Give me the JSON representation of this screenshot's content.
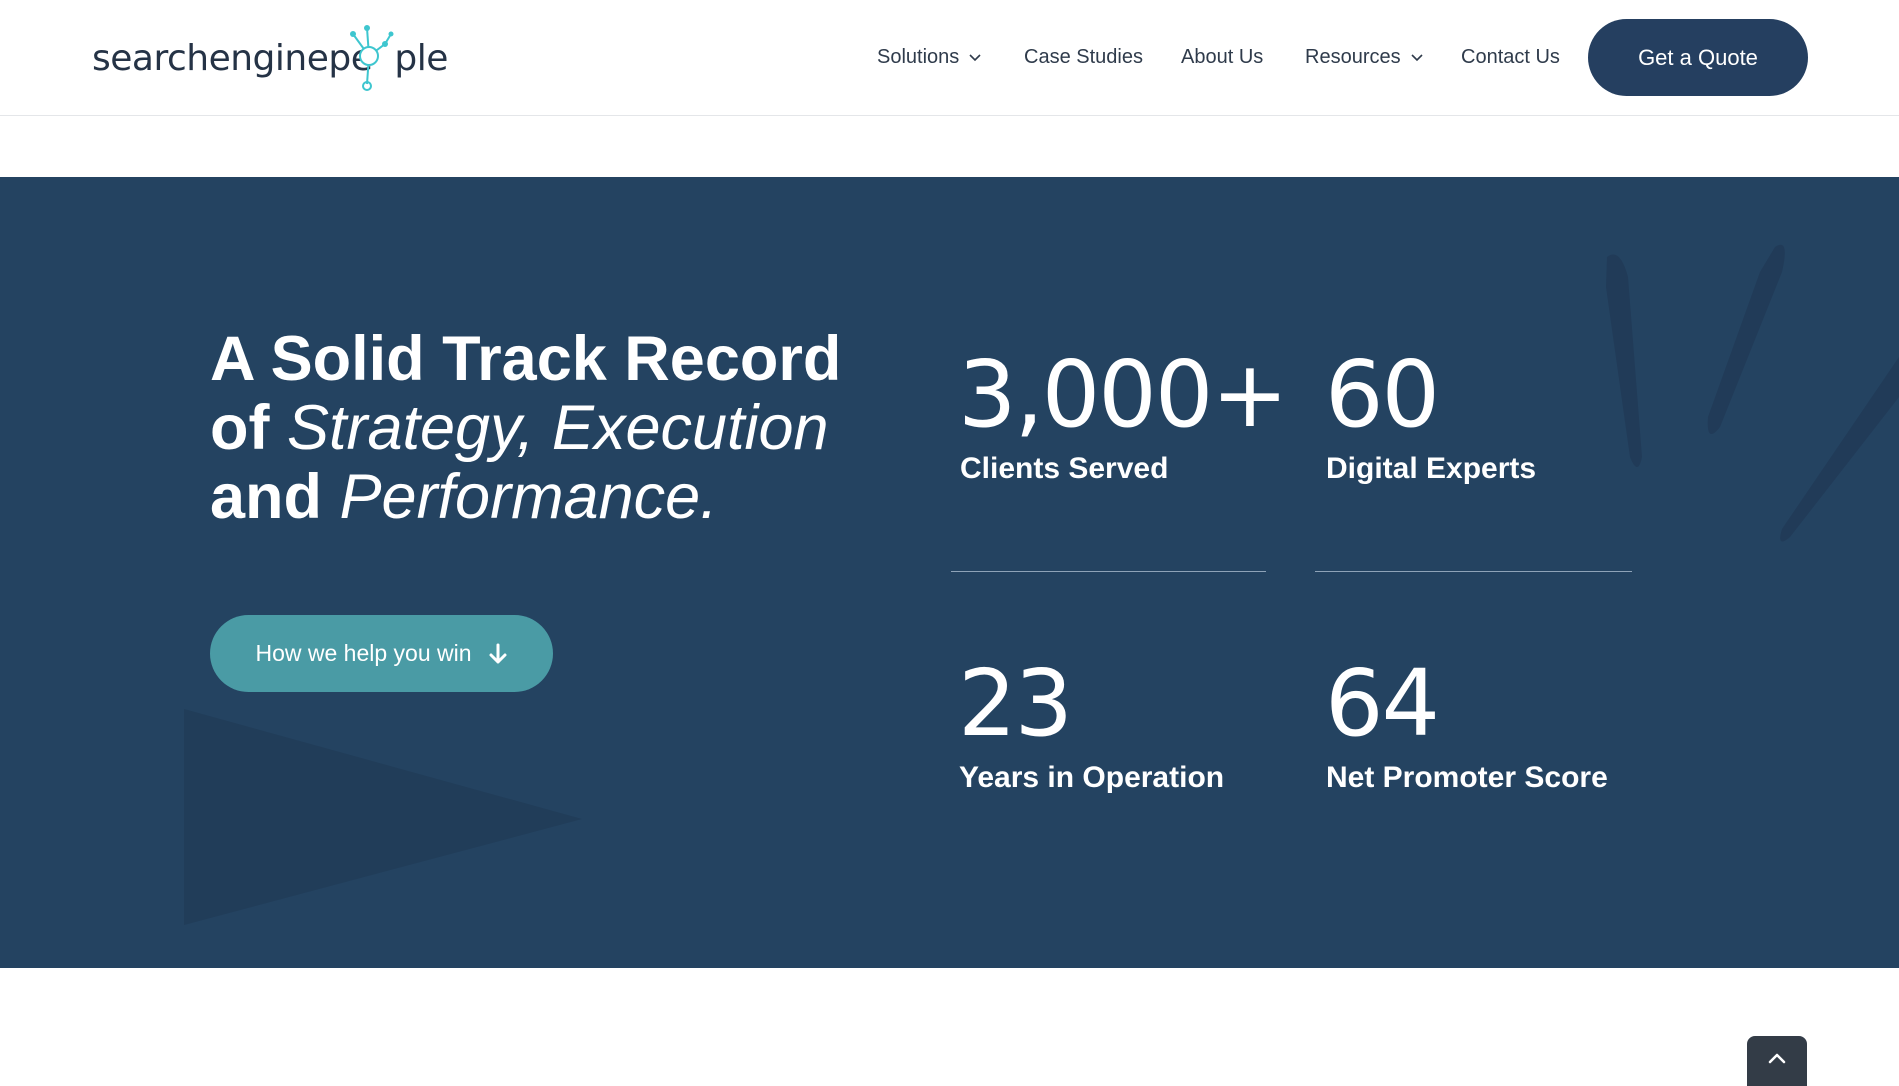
{
  "header": {
    "logo": {
      "part1": "searchengine",
      "part2": "pe",
      "part3": "ple",
      "icon": "node-network-icon"
    },
    "nav": [
      {
        "label": "Solutions",
        "has_dropdown": true
      },
      {
        "label": "Case Studies",
        "has_dropdown": false
      },
      {
        "label": "About Us",
        "has_dropdown": false
      },
      {
        "label": "Resources",
        "has_dropdown": true
      },
      {
        "label": "Contact Us",
        "has_dropdown": false
      }
    ],
    "quote_button": "Get a Quote"
  },
  "hero": {
    "headline": {
      "line1": "A Solid Track Record",
      "line2_bold": "of ",
      "line2_italic": "Strategy, Execution",
      "line3_bold": "and ",
      "line3_italic": "Performance."
    },
    "cta_label": "How we help you win",
    "cta_icon": "arrow-down-icon"
  },
  "stats": [
    {
      "value": "3,000+",
      "label": "Clients Served"
    },
    {
      "value": "60",
      "label": "Digital Experts"
    },
    {
      "value": "23",
      "label": "Years in Operation"
    },
    {
      "value": "64",
      "label": "Net Promoter Score"
    }
  ],
  "colors": {
    "band_bg": "#244361",
    "cta_bg": "#4a9ba5",
    "quote_bg": "#253f60",
    "logo_accent": "#3ec6cf"
  },
  "scroll_to_top_icon": "chevron-up-icon"
}
